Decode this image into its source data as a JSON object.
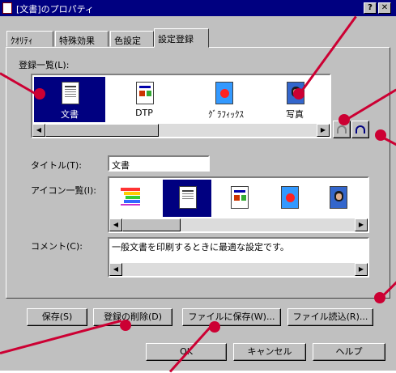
{
  "window": {
    "title": "[文書]のプロパティ",
    "help_button": "?",
    "close_button": "✕"
  },
  "tabs": [
    {
      "label": "ｸｵﾘﾃｨ"
    },
    {
      "label": "特殊効果"
    },
    {
      "label": "色設定"
    },
    {
      "label": "設定登録"
    }
  ],
  "registered_list": {
    "label": "登録一覧(L):",
    "items": [
      {
        "label": "文書",
        "icon": "document-icon",
        "selected": true
      },
      {
        "label": "DTP",
        "icon": "dtp-icon",
        "selected": false
      },
      {
        "label": "ｸﾞﾗﾌｨｯｸｽ",
        "icon": "graphics-icon",
        "selected": false
      },
      {
        "label": "写真",
        "icon": "photo-icon",
        "selected": false
      }
    ]
  },
  "title_field": {
    "label": "タイトル(T):",
    "value": "文書"
  },
  "icon_list": {
    "label": "アイコン一覧(I):",
    "icons": [
      "rainbow-3-icon",
      "document-icon",
      "dtp-icon",
      "graphics-icon",
      "photo-icon"
    ]
  },
  "comment_field": {
    "label": "コメント(C):",
    "value": "一般文書を印刷するときに最適な設定です。"
  },
  "action_buttons": {
    "save": "保存(S)",
    "delete": "登録の削除(D)",
    "save_file": "ファイルに保存(W)...",
    "load_file": "ファイル読込(R)..."
  },
  "footer_buttons": {
    "ok": "OK",
    "cancel": "キャンセル",
    "help": "ヘルプ"
  },
  "colors": {
    "title_bar": "#000080",
    "callout": "#cc0033",
    "selection": "#000080",
    "dialog_face": "#c0c0c0"
  }
}
